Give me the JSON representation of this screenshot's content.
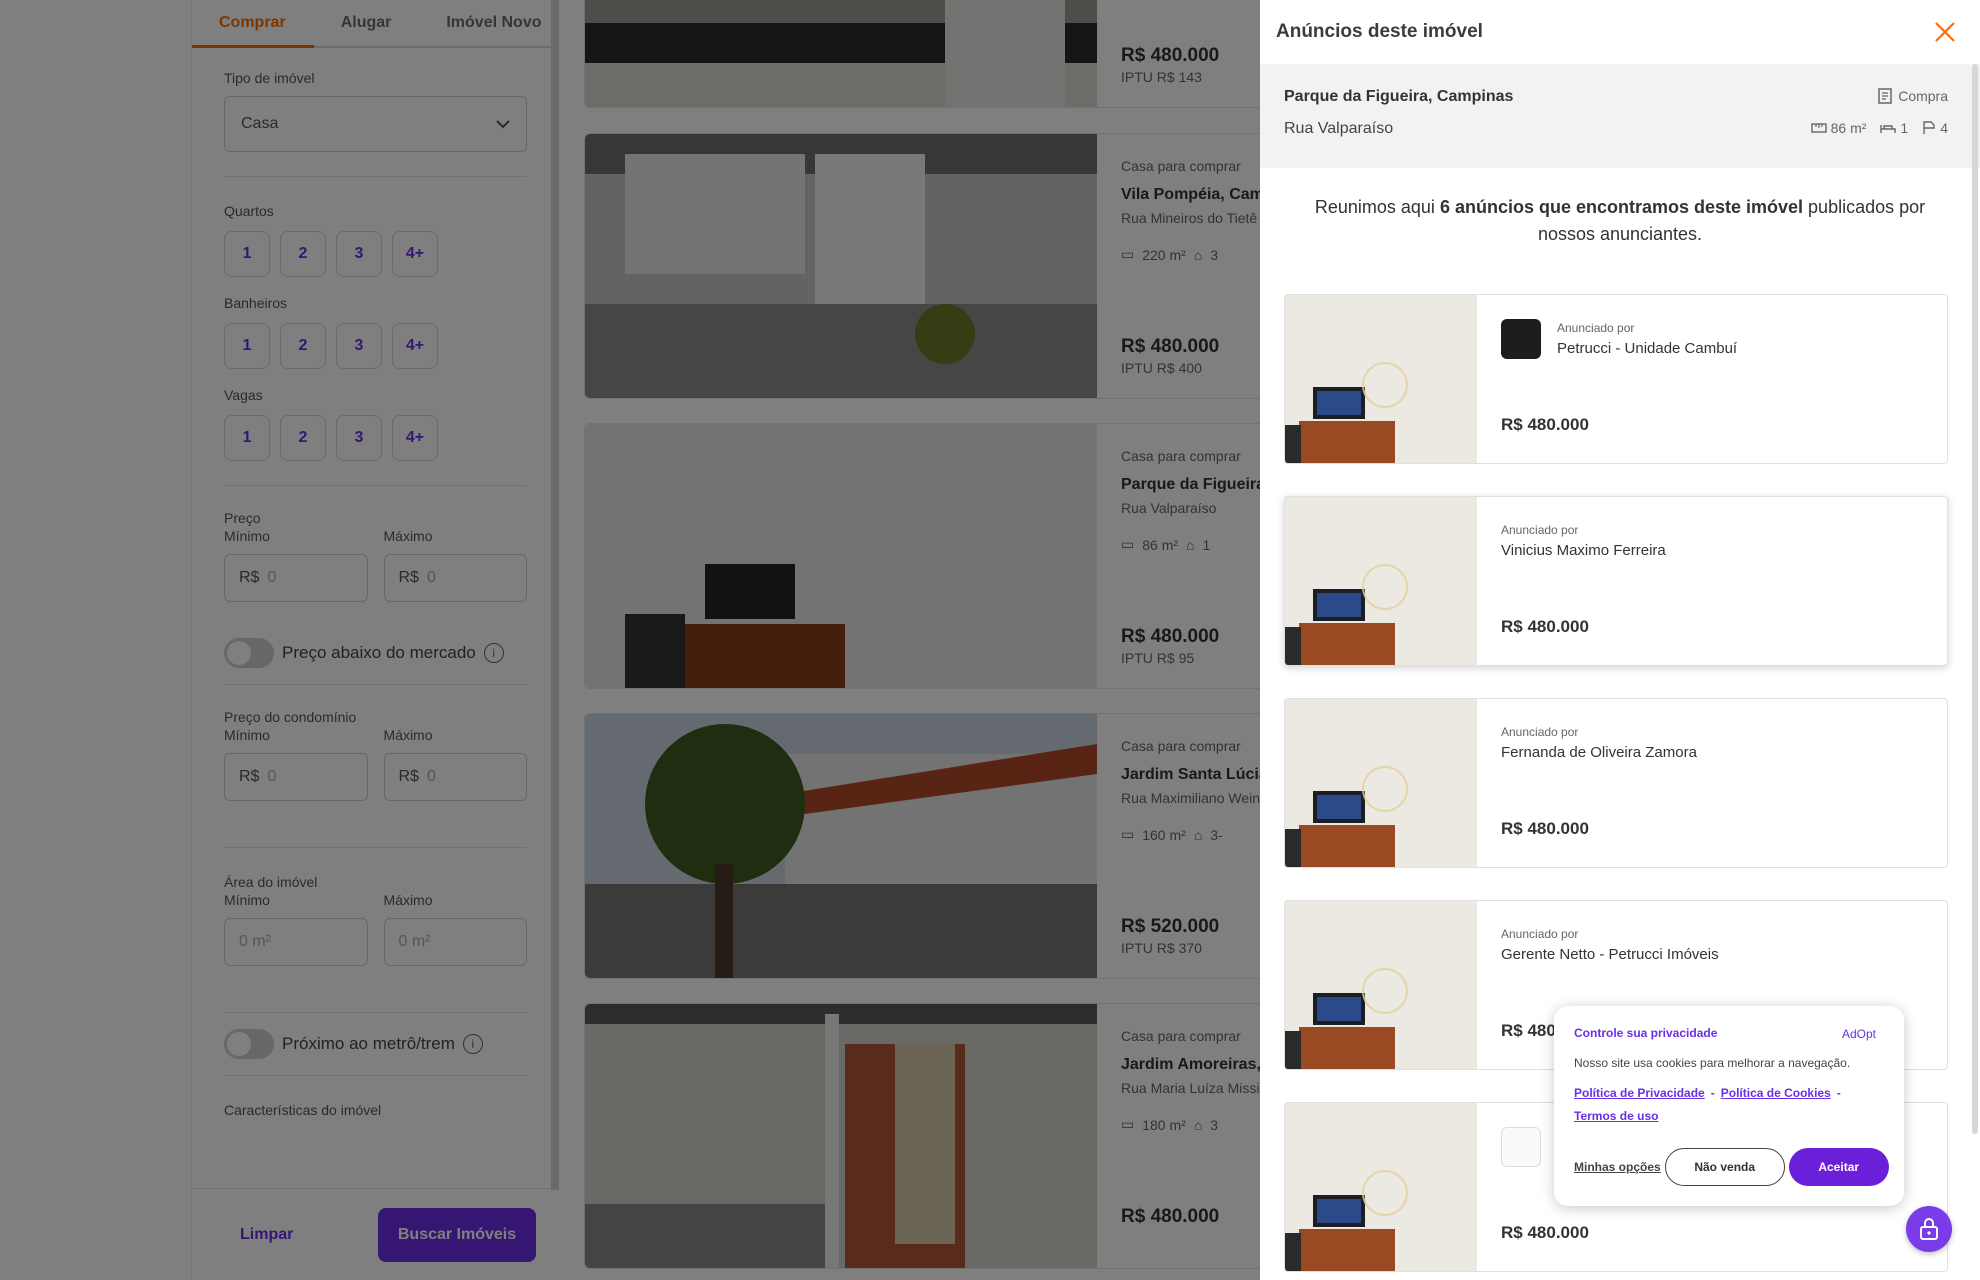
{
  "filters": {
    "tabs": [
      "Comprar",
      "Alugar",
      "Imóvel Novo"
    ],
    "property_type_label": "Tipo de imóvel",
    "property_type_value": "Casa",
    "rooms_label": "Quartos",
    "baths_label": "Banheiros",
    "parking_label": "Vagas",
    "chip_values": [
      "1",
      "2",
      "3",
      "4+"
    ],
    "price_label": "Preço",
    "min_label": "Mínimo",
    "max_label": "Máximo",
    "currency_prefix": "R$",
    "currency_placeholder": "0",
    "below_market_label": "Preço abaixo do mercado",
    "condo_label": "Preço do condomínio",
    "area_label": "Área do imóvel",
    "area_placeholder": "0 m²",
    "metro_label": "Próximo ao metrô/trem",
    "features_label": "Características do imóvel",
    "clear_label": "Limpar",
    "search_label": "Buscar Imóveis"
  },
  "results": [
    {
      "kind": "",
      "location": "",
      "street": "",
      "area": "",
      "rooms": "",
      "price": "R$ 480.000",
      "iptu": "IPTU R$ 143"
    },
    {
      "kind": "Casa para comprar",
      "location": "Vila Pompéia, Camp",
      "street": "Rua Mineiros do Tietê",
      "area": "220 m²",
      "rooms": "3",
      "price": "R$ 480.000",
      "iptu": "IPTU R$ 400"
    },
    {
      "kind": "Casa para comprar",
      "location": "Parque da Figueira,",
      "street": "Rua Valparaíso",
      "area": "86 m²",
      "rooms": "1",
      "price": "R$ 480.000",
      "iptu": "IPTU R$ 95"
    },
    {
      "kind": "Casa para comprar",
      "location": "Jardim Santa Lúcia",
      "street": "Rua Maximiliano Weini",
      "area": "160 m²",
      "rooms": "3-",
      "price": "R$ 520.000",
      "iptu": "IPTU R$ 370"
    },
    {
      "kind": "Casa para comprar",
      "location": "Jardim Amoreiras,",
      "street": "Rua Maria Luíza Missi",
      "area": "180 m²",
      "rooms": "3",
      "price": "R$ 480.000",
      "iptu": ""
    }
  ],
  "drawer": {
    "title": "Anúncios deste imóvel",
    "property_name": "Parque da Figueira, Campinas",
    "property_street": "Rua Valparaíso",
    "kind": "Compra",
    "area": "86 m²",
    "rooms": "1",
    "parking": "4",
    "intro_prefix": "Reunimos aqui ",
    "intro_bold": "6 anúncios que encontramos deste imóvel",
    "intro_suffix": " publicados por nossos anunciantes.",
    "announced_by": "Anunciado por",
    "ads": [
      {
        "advertiser": "Petrucci - Unidade Cambuí",
        "price": "R$ 480.000",
        "has_logo": true
      },
      {
        "advertiser": "Vinicius Maximo Ferreira",
        "price": "R$ 480.000",
        "has_logo": false
      },
      {
        "advertiser": "Fernanda de Oliveira Zamora",
        "price": "R$ 480.000",
        "has_logo": false
      },
      {
        "advertiser": "Gerente Netto - Petrucci Imóveis",
        "price": "R$ 480",
        "has_logo": false
      },
      {
        "advertiser": "",
        "price": "R$ 480.000",
        "has_logo": true
      }
    ]
  },
  "privacy": {
    "title": "Controle sua privacidade",
    "brand": "AdOpt",
    "text": "Nosso site usa cookies para melhorar a navegação.",
    "link_privacy": "Política de Privacidade",
    "link_cookies": "Política de Cookies",
    "link_terms": "Termos de uso",
    "separator": "-",
    "options": "Minhas opções",
    "no_sell": "Não venda",
    "accept": "Aceitar"
  },
  "colors": {
    "accent": "#6a2fe6",
    "orange": "#ff6a00"
  }
}
